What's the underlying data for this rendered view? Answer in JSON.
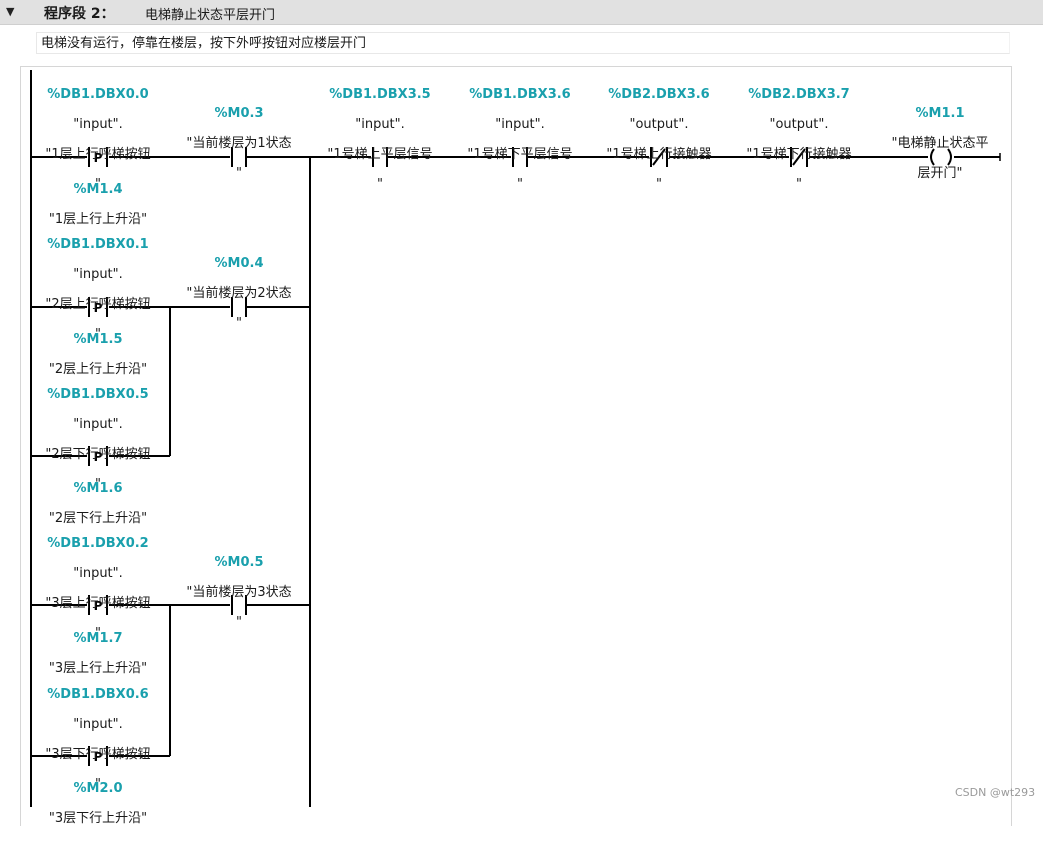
{
  "segment": {
    "title": "程序段 2：",
    "description": "电梯静止状态平层开门",
    "comment": "电梯没有运行，停靠在楼层，按下外呼按钮对应楼层开门"
  },
  "contacts": {
    "c1": {
      "addr": "%DB1.DBX0.0",
      "line1": "\"input\".",
      "line2": "\"1层上行呼梯按钮",
      "line3": "\""
    },
    "p1": {
      "addr": "%M1.4",
      "sym": "\"1层上行上升沿\""
    },
    "m03": {
      "addr": "%M0.3",
      "line1": "\"当前楼层为1状态",
      "line2": "\""
    },
    "db135": {
      "addr": "%DB1.DBX3.5",
      "line1": "\"input\".",
      "line2": "\"1号梯上平层信号",
      "line3": "\""
    },
    "db136": {
      "addr": "%DB1.DBX3.6",
      "line1": "\"input\".",
      "line2": "\"1号梯下平层信号",
      "line3": "\""
    },
    "db236": {
      "addr": "%DB2.DBX3.6",
      "line1": "\"output\".",
      "line2": "\"1号梯上行接触器",
      "line3": "\""
    },
    "db237": {
      "addr": "%DB2.DBX3.7",
      "line1": "\"output\".",
      "line2": "\"1号梯下行接触器",
      "line3": "\""
    },
    "coil": {
      "addr": "%M1.1",
      "line1": "\"电梯静止状态平",
      "line2": "层开门\""
    },
    "c2": {
      "addr": "%DB1.DBX0.1",
      "line1": "\"input\".",
      "line2": "\"2层上行呼梯按钮",
      "line3": "\""
    },
    "p2": {
      "addr": "%M1.5",
      "sym": "\"2层上行上升沿\""
    },
    "m04": {
      "addr": "%M0.4",
      "line1": "\"当前楼层为2状态",
      "line2": "\""
    },
    "c3": {
      "addr": "%DB1.DBX0.5",
      "line1": "\"input\".",
      "line2": "\"2层下行呼梯按钮",
      "line3": "\""
    },
    "p3": {
      "addr": "%M1.6",
      "sym": "\"2层下行上升沿\""
    },
    "c4": {
      "addr": "%DB1.DBX0.2",
      "line1": "\"input\".",
      "line2": "\"3层上行呼梯按钮",
      "line3": "\""
    },
    "p4": {
      "addr": "%M1.7",
      "sym": "\"3层上行上升沿\""
    },
    "m05": {
      "addr": "%M0.5",
      "line1": "\"当前楼层为3状态",
      "line2": "\""
    },
    "c5": {
      "addr": "%DB1.DBX0.6",
      "line1": "\"input\".",
      "line2": "\"3层下行呼梯按钮",
      "line3": "\""
    },
    "p5": {
      "addr": "%M2.0",
      "sym": "\"3层下行上升沿\""
    }
  },
  "elements": {
    "p_label": "P",
    "coil_label": "(  )"
  },
  "watermark": "CSDN @wt293",
  "colors": {
    "address": "#1aa0ad",
    "header_bg": "#e1e1e1"
  },
  "icons": {
    "toggle": "collapse-triangle-icon"
  }
}
